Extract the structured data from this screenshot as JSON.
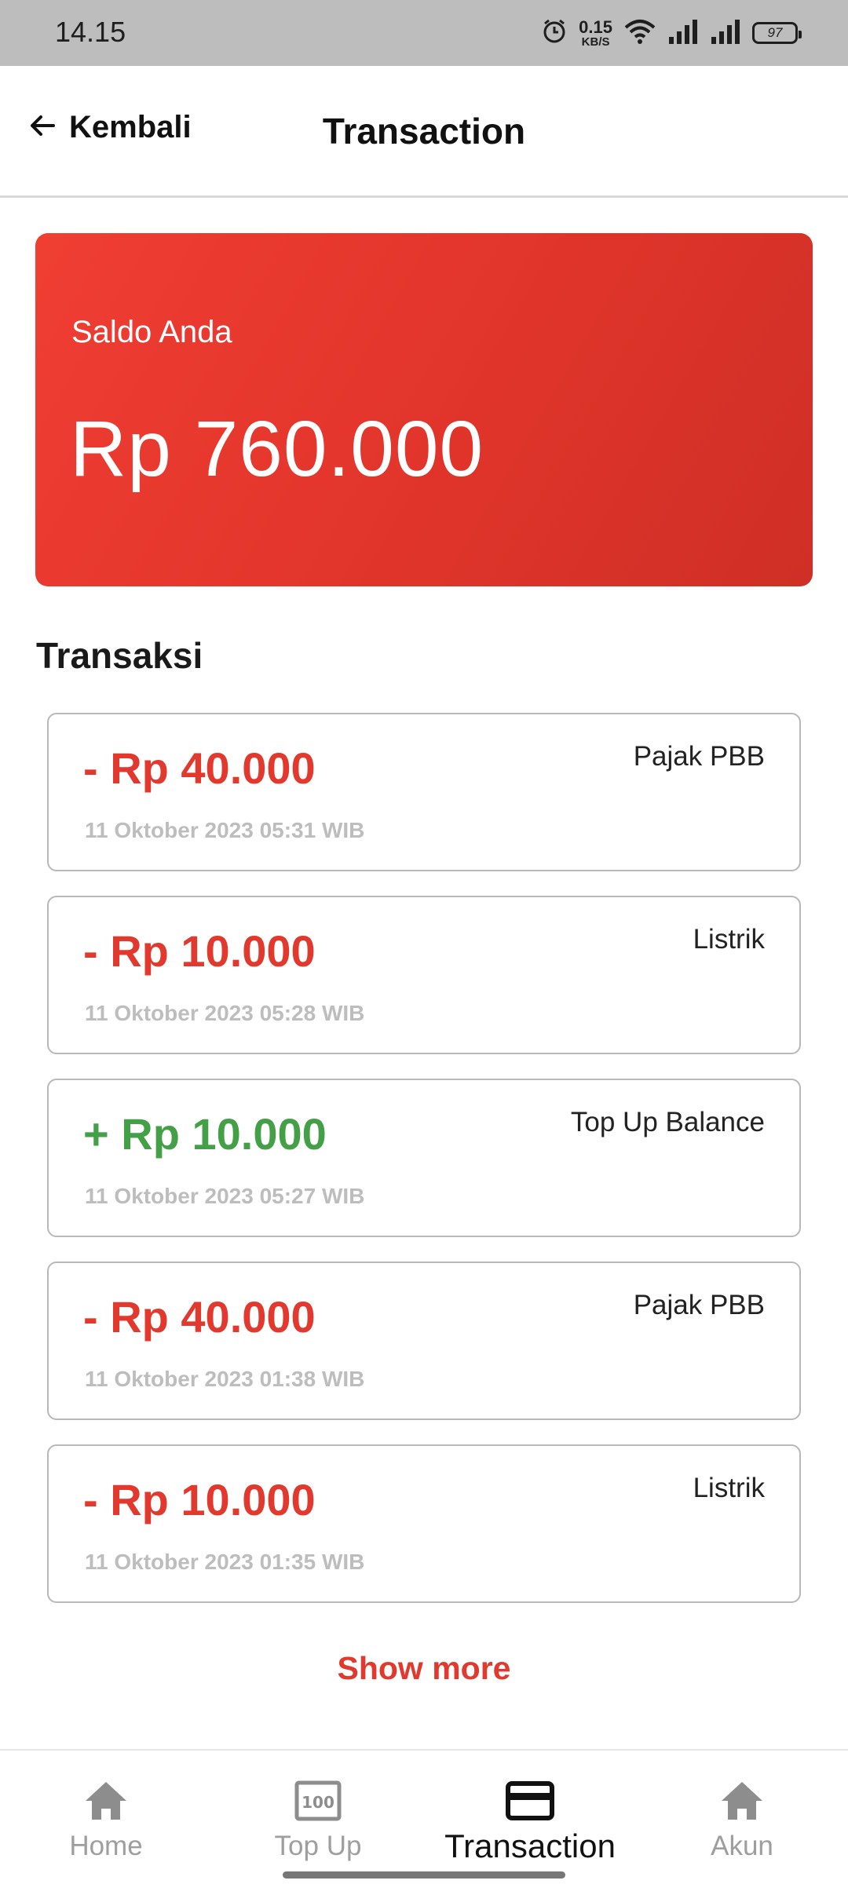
{
  "status_bar": {
    "time": "14.15",
    "net_speed": "0.15",
    "net_unit": "KB/S",
    "battery": "97",
    "icons": [
      "alarm-icon",
      "wifi-icon",
      "signal-icon",
      "signal-icon",
      "battery-icon"
    ]
  },
  "appbar": {
    "back_label": "Kembali",
    "title": "Transaction"
  },
  "balance": {
    "label": "Saldo Anda",
    "amount": "Rp 760.000"
  },
  "transactions_title": "Transaksi",
  "transactions": [
    {
      "amount": "- Rp 40.000",
      "date": "11 Oktober 2023 05:31 WIB",
      "category": "Pajak PBB",
      "type": "debit"
    },
    {
      "amount": "- Rp 10.000",
      "date": "11 Oktober 2023 05:28 WIB",
      "category": "Listrik",
      "type": "debit"
    },
    {
      "amount": "+ Rp 10.000",
      "date": "11 Oktober 2023 05:27 WIB",
      "category": "Top Up Balance",
      "type": "credit"
    },
    {
      "amount": "- Rp 40.000",
      "date": "11 Oktober 2023 01:38 WIB",
      "category": "Pajak PBB",
      "type": "debit"
    },
    {
      "amount": "- Rp 10.000",
      "date": "11 Oktober 2023 01:35 WIB",
      "category": "Listrik",
      "type": "debit"
    }
  ],
  "show_more": "Show more",
  "nav": {
    "items": [
      {
        "label": "Home",
        "icon": "home-icon"
      },
      {
        "label": "Top Up",
        "icon": "top-up-icon"
      },
      {
        "label": "Transaction",
        "icon": "card-icon",
        "active": true
      },
      {
        "label": "Akun",
        "icon": "home-icon"
      }
    ]
  },
  "colors": {
    "accent": "#e1392d",
    "credit": "#43a047",
    "card_start": "#f03e33",
    "card_end": "#cf2f26"
  }
}
